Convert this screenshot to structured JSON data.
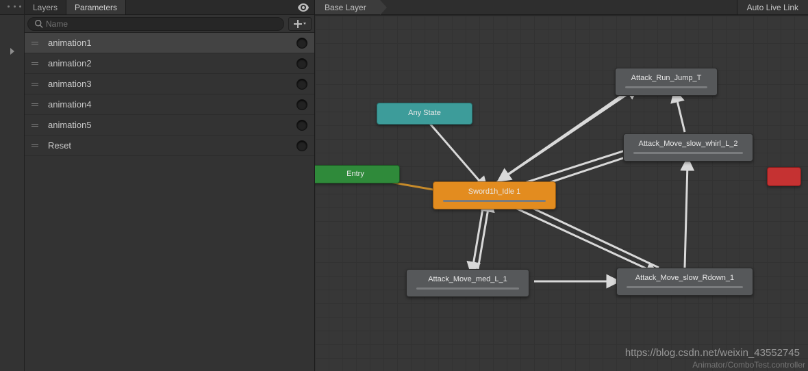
{
  "tabs": {
    "layers": "Layers",
    "parameters": "Parameters"
  },
  "search": {
    "placeholder": "Name"
  },
  "params": [
    {
      "name": "animation1",
      "selected": true
    },
    {
      "name": "animation2",
      "selected": false
    },
    {
      "name": "animation3",
      "selected": false
    },
    {
      "name": "animation4",
      "selected": false
    },
    {
      "name": "animation5",
      "selected": false
    },
    {
      "name": "Reset",
      "selected": false
    }
  ],
  "breadcrumb": {
    "layer": "Base Layer"
  },
  "autolink": "Auto Live Link",
  "states": {
    "anyState": "Any State",
    "entry": "Entry",
    "default": "Sword1h_Idle 1",
    "a": "Attack_Run_Jump_T",
    "b": "Attack_Move_slow_whirl_L_2",
    "c": "Attack_Move_med_L_1",
    "d": "Attack_Move_slow_Rdown_1"
  },
  "watermark": "https://blog.csdn.net/weixin_43552745",
  "assetLabel": "Animator/ComboTest.controller"
}
